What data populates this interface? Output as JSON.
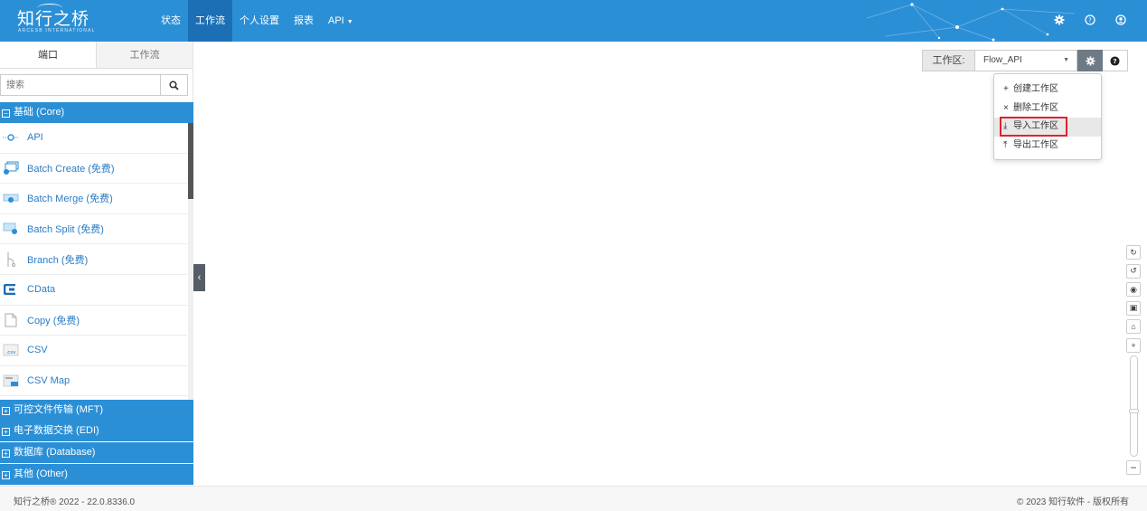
{
  "brand": {
    "logo_text": "知行之桥",
    "logo_sub": "ARCESB INTERNATIONAL"
  },
  "nav": [
    {
      "label": "状态",
      "active": false
    },
    {
      "label": "工作流",
      "active": true
    },
    {
      "label": "个人设置",
      "active": false
    },
    {
      "label": "报表",
      "active": false
    },
    {
      "label": "API",
      "active": false,
      "dropdown": true
    }
  ],
  "top_icons": [
    "gear-icon",
    "help-icon",
    "user-icon"
  ],
  "left_tabs": {
    "ports": "端口",
    "flows": "工作流"
  },
  "search": {
    "placeholder": "搜索"
  },
  "categories": {
    "core": "基础 (Core)",
    "mft": "可控文件传输 (MFT)",
    "edi": "电子数据交换 (EDI)",
    "db": "数据库 (Database)",
    "other": "其他 (Other)"
  },
  "ports": [
    {
      "label": "API",
      "icon": "api-icon"
    },
    {
      "label": "Batch Create (免费)",
      "icon": "batch-create-icon"
    },
    {
      "label": "Batch Merge (免费)",
      "icon": "batch-merge-icon"
    },
    {
      "label": "Batch Split (免费)",
      "icon": "batch-split-icon"
    },
    {
      "label": "Branch (免费)",
      "icon": "branch-icon"
    },
    {
      "label": "CData",
      "icon": "cdata-icon"
    },
    {
      "label": "Copy (免费)",
      "icon": "copy-icon"
    },
    {
      "label": "CSV",
      "icon": "csv-icon"
    },
    {
      "label": "CSV Map",
      "icon": "csv-map-icon"
    }
  ],
  "workspace": {
    "label": "工作区:",
    "value": "Flow_API"
  },
  "workspace_menu": [
    {
      "label": "创建工作区",
      "icon": "+"
    },
    {
      "label": "删除工作区",
      "icon": "×"
    },
    {
      "label": "导入工作区",
      "icon": "⤓"
    },
    {
      "label": "导出工作区",
      "icon": "⤒"
    }
  ],
  "footer": {
    "left": "知行之桥® 2022 - 22.0.8336.0",
    "right": "© 2023 知行软件 - 版权所有"
  },
  "colors": {
    "primary": "#2b8fd6",
    "nav_active": "#1c6fb5",
    "link": "#2b7cc4",
    "highlight": "#e0232b"
  }
}
